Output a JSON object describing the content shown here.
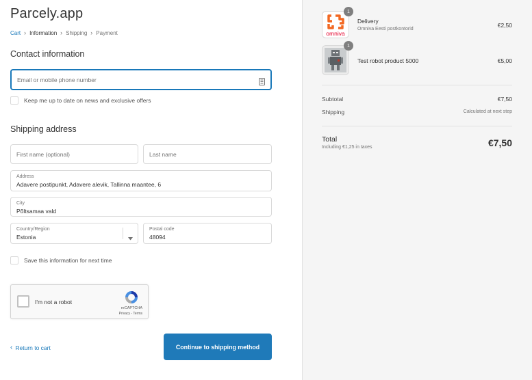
{
  "brand": "Parcely.app",
  "breadcrumb": {
    "cart": "Cart",
    "information": "Information",
    "shipping": "Shipping",
    "payment": "Payment"
  },
  "contact": {
    "title": "Contact information",
    "email_placeholder": "Email or mobile phone number",
    "newsletter_label": "Keep me up to date on news and exclusive offers"
  },
  "shipping_address": {
    "title": "Shipping address",
    "first_name_placeholder": "First name (optional)",
    "last_name_placeholder": "Last name",
    "address_label": "Address",
    "address_value": "Adavere postipunkt, Adavere alevik, Tallinna maantee, 6",
    "city_label": "City",
    "city_value": "Põltsamaa vald",
    "country_label": "Country/Region",
    "country_value": "Estonia",
    "postal_label": "Postal code",
    "postal_value": "48094",
    "save_label": "Save this information for next time"
  },
  "captcha": {
    "label": "I'm not a robot",
    "brand": "reCAPTCHA",
    "terms": "Privacy - Terms"
  },
  "actions": {
    "return_label": "Return to cart",
    "continue_label": "Continue to shipping method"
  },
  "order": {
    "items": [
      {
        "name": "Delivery",
        "subtitle": "Omniva Eesti postkontorid",
        "price": "€2,50",
        "quantity": "1",
        "logo_text": "omniva"
      },
      {
        "name": "Test robot product 5000",
        "price": "€5,00",
        "quantity": "1"
      }
    ],
    "subtotal_label": "Subtotal",
    "subtotal_value": "€7,50",
    "shipping_label": "Shipping",
    "shipping_value": "Calculated at next step",
    "total_label": "Total",
    "taxes_note": "Including €1,25 in taxes",
    "total_value": "€7,50"
  },
  "colors": {
    "accent": "#1878b9",
    "button": "#1f7ab9",
    "omniva": "#f26822",
    "sidebar_bg": "#f5f5f5"
  }
}
